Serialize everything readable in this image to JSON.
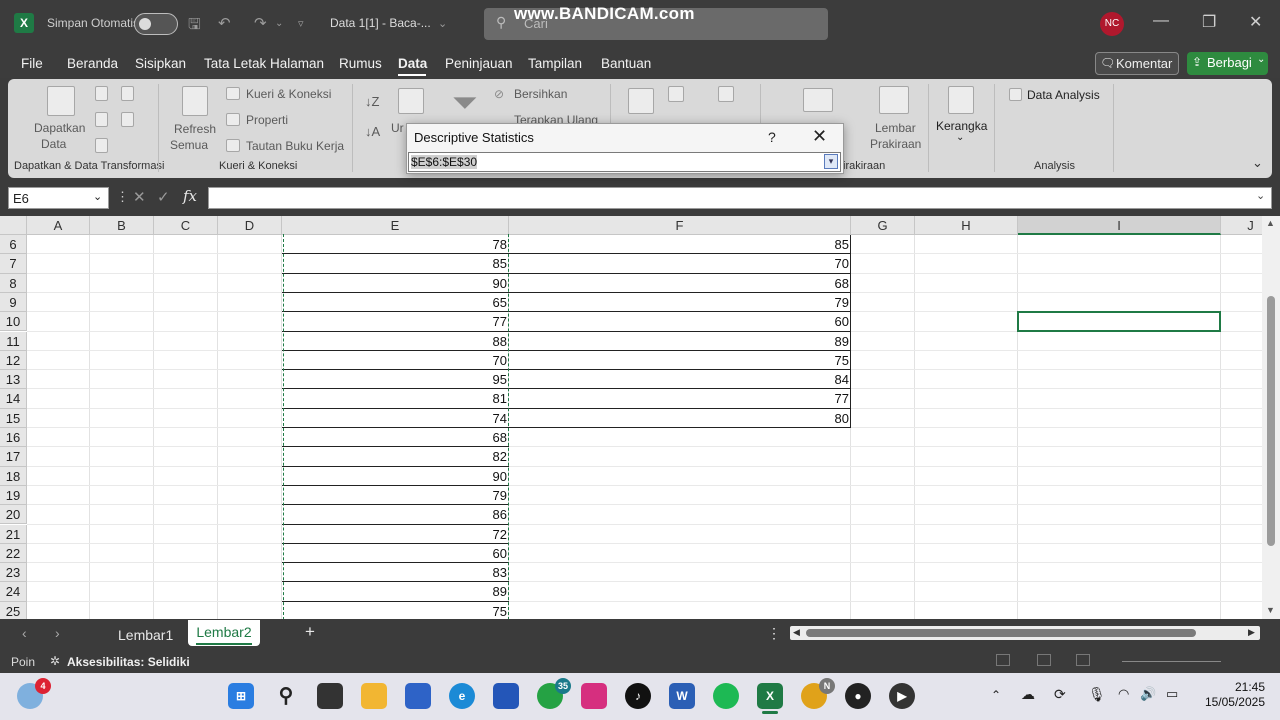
{
  "title_bar": {
    "autosave_label": "Simpan Otomatis",
    "document_title": "Data 1[1]  -  Baca-...",
    "search_placeholder": "Cari",
    "watermark": "www.BANDICAM.com",
    "user_initials": "NC"
  },
  "menu": {
    "items": [
      "File",
      "Beranda",
      "Sisipkan",
      "Tata Letak Halaman",
      "Rumus",
      "Data",
      "Peninjauan",
      "Tampilan",
      "Bantuan"
    ],
    "active": "Data",
    "comment_button": "Komentar",
    "share_button": "Berbagi"
  },
  "ribbon": {
    "get_data": "Dapatkan",
    "get_data_2": "Data",
    "refresh": "Refresh",
    "refresh_2": "Semua",
    "queries": "Kueri & Koneksi",
    "properties": "Properti",
    "workbook_links": "Tautan Buku Kerja",
    "clear": "Bersihkan",
    "reapply": "Terapkan Ulang",
    "forecast_sheet": "Lembar",
    "forecast_sheet_2": "Prakiraan",
    "outline": "Kerangka",
    "data_analysis": "Data Analysis",
    "group_get_transform": "Dapatkan & Data Transformasi",
    "group_queries": "Kueri & Koneksi",
    "group_forecast": "irakiraan",
    "group_analysis": "Analysis",
    "sort_label": "Ur"
  },
  "formula_bar": {
    "name_box": "E6",
    "fx": "fx",
    "formula": ""
  },
  "grid": {
    "columns": [
      "A",
      "B",
      "C",
      "D",
      "E",
      "F",
      "G",
      "H",
      "I",
      "J"
    ],
    "rows": [
      "6",
      "7",
      "8",
      "9",
      "10",
      "11",
      "12",
      "13",
      "14",
      "15",
      "16",
      "17",
      "18",
      "19",
      "20",
      "21",
      "22",
      "23",
      "24",
      "25"
    ],
    "col_e": [
      "78",
      "85",
      "90",
      "65",
      "77",
      "88",
      "70",
      "95",
      "81",
      "74",
      "68",
      "82",
      "90",
      "79",
      "86",
      "72",
      "60",
      "83",
      "89",
      "75"
    ],
    "col_f": [
      "85",
      "70",
      "68",
      "79",
      "60",
      "89",
      "75",
      "84",
      "77",
      "80"
    ]
  },
  "dialog": {
    "title": "Descriptive Statistics",
    "help": "?",
    "close": "✕",
    "range_value": "$E$6:$E$30"
  },
  "sheets": {
    "tabs": [
      "Lembar1",
      "Lembar2"
    ],
    "active": "Lembar2",
    "add": "+"
  },
  "status": {
    "mode": "Poin",
    "accessibility": "Aksesibilitas: Selidiki"
  },
  "taskbar": {
    "weather_badge": "4",
    "whatsapp_badge": "35",
    "chrome_badge": "N",
    "time": "21:45",
    "date": "15/05/2025"
  },
  "colors": {
    "excel_green": "#1f7a45",
    "share_green": "#2e8b3f",
    "avatar_red": "#b0182d"
  }
}
